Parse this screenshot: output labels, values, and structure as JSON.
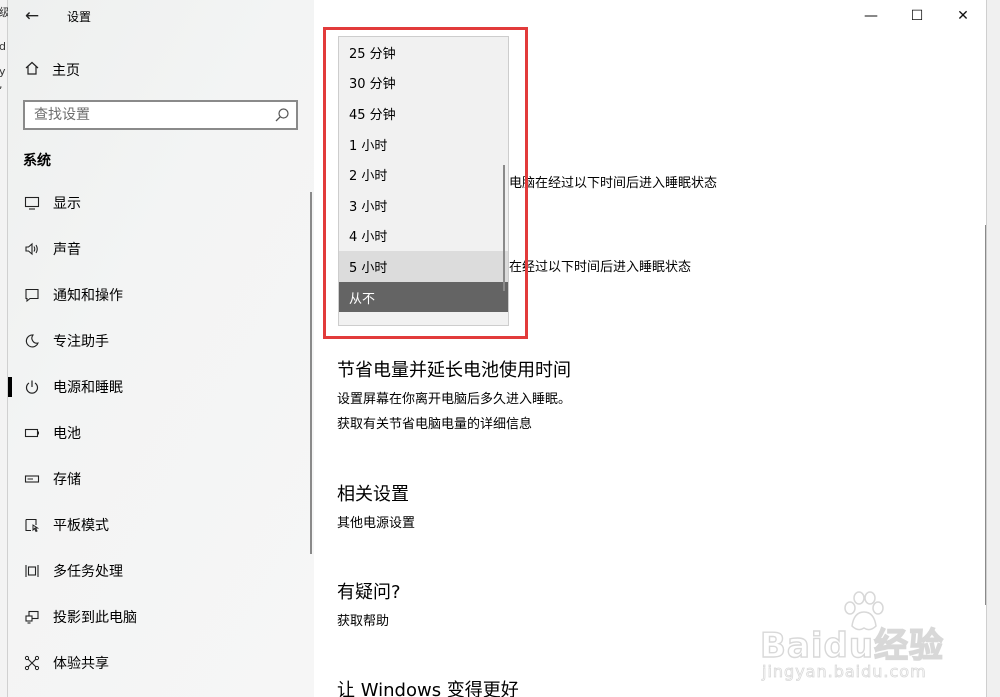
{
  "background_window": {
    "chars": [
      "级",
      "d",
      "y ,"
    ]
  },
  "window": {
    "title": "设置",
    "back_glyph": "←",
    "minimize_glyph": "—",
    "maximize_glyph": "☐",
    "close_glyph": "✕"
  },
  "sidebar": {
    "home_label": "主页",
    "search_placeholder": "查找设置",
    "section_title": "系统",
    "items": [
      {
        "label": "显示",
        "icon": "monitor-icon"
      },
      {
        "label": "声音",
        "icon": "speaker-icon"
      },
      {
        "label": "通知和操作",
        "icon": "notification-icon"
      },
      {
        "label": "专注助手",
        "icon": "moon-icon"
      },
      {
        "label": "电源和睡眠",
        "icon": "power-icon",
        "active": true
      },
      {
        "label": "电池",
        "icon": "battery-icon"
      },
      {
        "label": "存储",
        "icon": "storage-icon"
      },
      {
        "label": "平板模式",
        "icon": "tablet-mode-icon"
      },
      {
        "label": "多任务处理",
        "icon": "multitask-icon"
      },
      {
        "label": "投影到此电脑",
        "icon": "project-icon"
      },
      {
        "label": "体验共享",
        "icon": "share-icon"
      }
    ]
  },
  "main": {
    "partial_line1": "电脑在经过以下时间后进入睡眠状态",
    "partial_line2": "在经过以下时间后进入睡眠状态",
    "save_power": {
      "title": "节省电量并延长电池使用时间",
      "description": "设置屏幕在你离开电脑后多久进入睡眠。",
      "link": "获取有关节省电脑电量的详细信息"
    },
    "related": {
      "title": "相关设置",
      "link": "其他电源设置"
    },
    "help": {
      "title": "有疑问?",
      "link": "获取帮助"
    },
    "bottom_partial": "让 Windows 变得更好"
  },
  "dropdown": {
    "options": [
      "25 分钟",
      "30 分钟",
      "45 分钟",
      "1 小时",
      "2 小时",
      "3 小时",
      "4 小时",
      "5 小时",
      "从不"
    ],
    "hovered": "5 小时",
    "selected": "从不"
  },
  "watermark": {
    "brand": "Baidu经验",
    "site": "jingyan.baidu.com"
  },
  "colors": {
    "highlight_box": "#e23b3b",
    "selected_option": "#646464",
    "hover_option": "#dcdcdc"
  }
}
